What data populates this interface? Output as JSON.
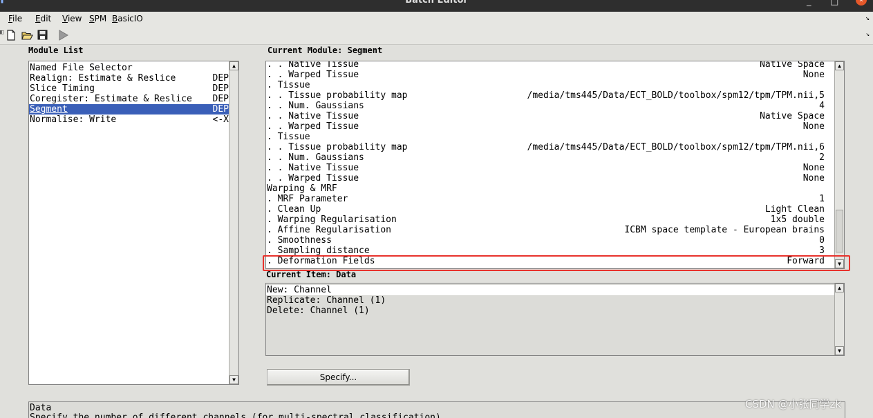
{
  "window": {
    "title": "Batch Editor",
    "controls": [
      "_",
      "□",
      "×"
    ]
  },
  "menu": [
    "File",
    "Edit",
    "View",
    "SPM",
    "BasicIO"
  ],
  "toolbar": {
    "buttons": [
      "new-file-icon",
      "open-folder-icon",
      "save-icon",
      "run-icon"
    ],
    "overflow_arrow": "↘"
  },
  "module_list": {
    "label": "Module List",
    "items": [
      {
        "name": "Named File Selector",
        "status": ""
      },
      {
        "name": "Realign: Estimate & Reslice",
        "status": "DEP"
      },
      {
        "name": "Slice Timing",
        "status": "DEP"
      },
      {
        "name": "Coregister: Estimate & Reslice",
        "status": "DEP"
      },
      {
        "name": "Segment",
        "status": "DEP",
        "selected": true
      },
      {
        "name": "Normalise: Write",
        "status": "<-X"
      }
    ]
  },
  "current_module": {
    "label": "Current Module: Segment",
    "rows": [
      {
        "k": ". . Native Tissue",
        "v": "Native Space"
      },
      {
        "k": ". . Warped Tissue",
        "v": "None"
      },
      {
        "k": ". Tissue",
        "v": ""
      },
      {
        "k": ". . Tissue probability map",
        "v": "/media/tms445/Data/ECT_BOLD/toolbox/spm12/tpm/TPM.nii,5"
      },
      {
        "k": ". . Num. Gaussians",
        "v": "4"
      },
      {
        "k": ". . Native Tissue",
        "v": "Native Space"
      },
      {
        "k": ". . Warped Tissue",
        "v": "None"
      },
      {
        "k": ". Tissue",
        "v": ""
      },
      {
        "k": ". . Tissue probability map",
        "v": "/media/tms445/Data/ECT_BOLD/toolbox/spm12/tpm/TPM.nii,6"
      },
      {
        "k": ". . Num. Gaussians",
        "v": "2"
      },
      {
        "k": ". . Native Tissue",
        "v": "None"
      },
      {
        "k": ". . Warped Tissue",
        "v": "None"
      },
      {
        "k": "Warping & MRF",
        "v": ""
      },
      {
        "k": ". MRF Parameter",
        "v": "1"
      },
      {
        "k": ". Clean Up",
        "v": "Light Clean"
      },
      {
        "k": ". Warping Regularisation",
        "v": "1x5 double"
      },
      {
        "k": ". Affine Regularisation",
        "v": "ICBM space template - European brains"
      },
      {
        "k": ". Smoothness",
        "v": "0"
      },
      {
        "k": ". Sampling distance",
        "v": "3"
      },
      {
        "k": ". Deformation Fields",
        "v": "Forward",
        "highlighted": true
      }
    ]
  },
  "current_item": {
    "label": "Current Item: Data",
    "options": [
      "New: Channel",
      "Replicate: Channel (1)",
      "Delete: Channel (1)"
    ]
  },
  "specify_button": "Specify...",
  "help": {
    "title": "Data",
    "text": "Specify the number of different channels (for multi-spectral classification)"
  },
  "watermark": "CSDN @小张同学zk",
  "colors": {
    "selection": "#3a5fb8",
    "highlight_box": "#e8322c"
  }
}
